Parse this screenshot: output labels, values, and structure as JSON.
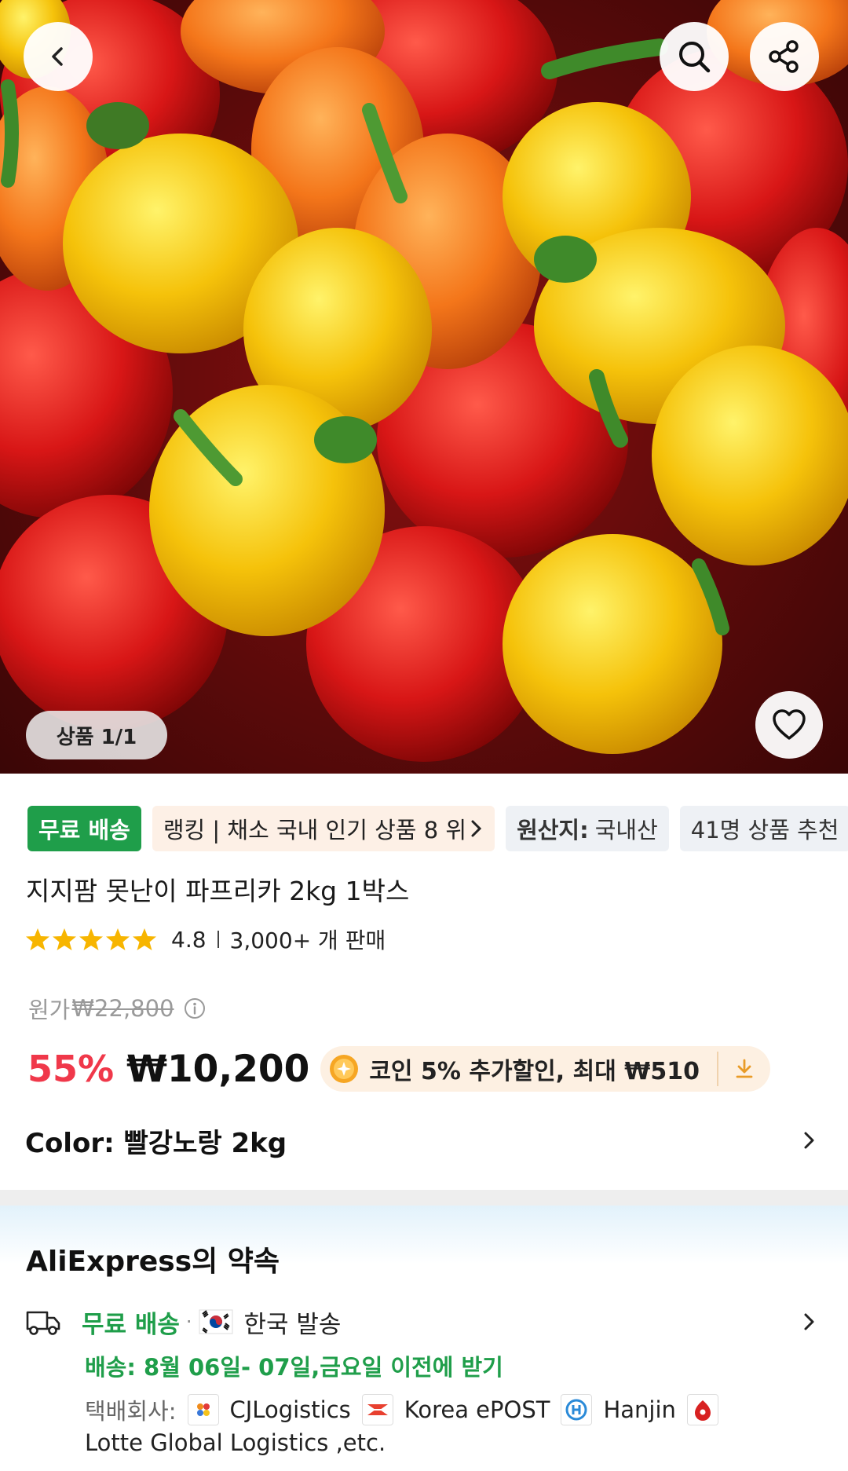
{
  "hero": {
    "pager_text": "상품 1/1"
  },
  "badges": {
    "free_shipping": "무료 배송",
    "ranking": "랭킹 | 채소 국내 인기 상품 8 위",
    "origin_key": "원산지:",
    "origin_value": "국내산",
    "recommend": "41명 상품 추천"
  },
  "product": {
    "title": "지지팜 못난이 파프리카 2kg 1박스",
    "rating": "4.8",
    "sold": "3,000+ 개 판매",
    "original_label": "원가",
    "original_price": "₩22,800",
    "discount": "55%",
    "price": "₩10,200",
    "coin_text": "코인 5% 추가할인, 최대 ₩510",
    "color_label": "Color: 빨강노랑 2kg"
  },
  "promise": {
    "title": "AliExpress의 약속",
    "free_shipping": "무료 배송",
    "dot": "·",
    "ship_from": "한국 발송",
    "delivery": "배송: 8월 06일- 07일,금요일 이전에 받기",
    "carrier_label": "택배회사:",
    "carriers": [
      "CJLogistics",
      "Korea ePOST",
      "Hanjin",
      "Lotte Global Logistics ,etc."
    ]
  },
  "colors": {
    "green": "#1f9e4a",
    "discount_red": "#f0384a",
    "coin_bg": "#fdf0e2"
  }
}
